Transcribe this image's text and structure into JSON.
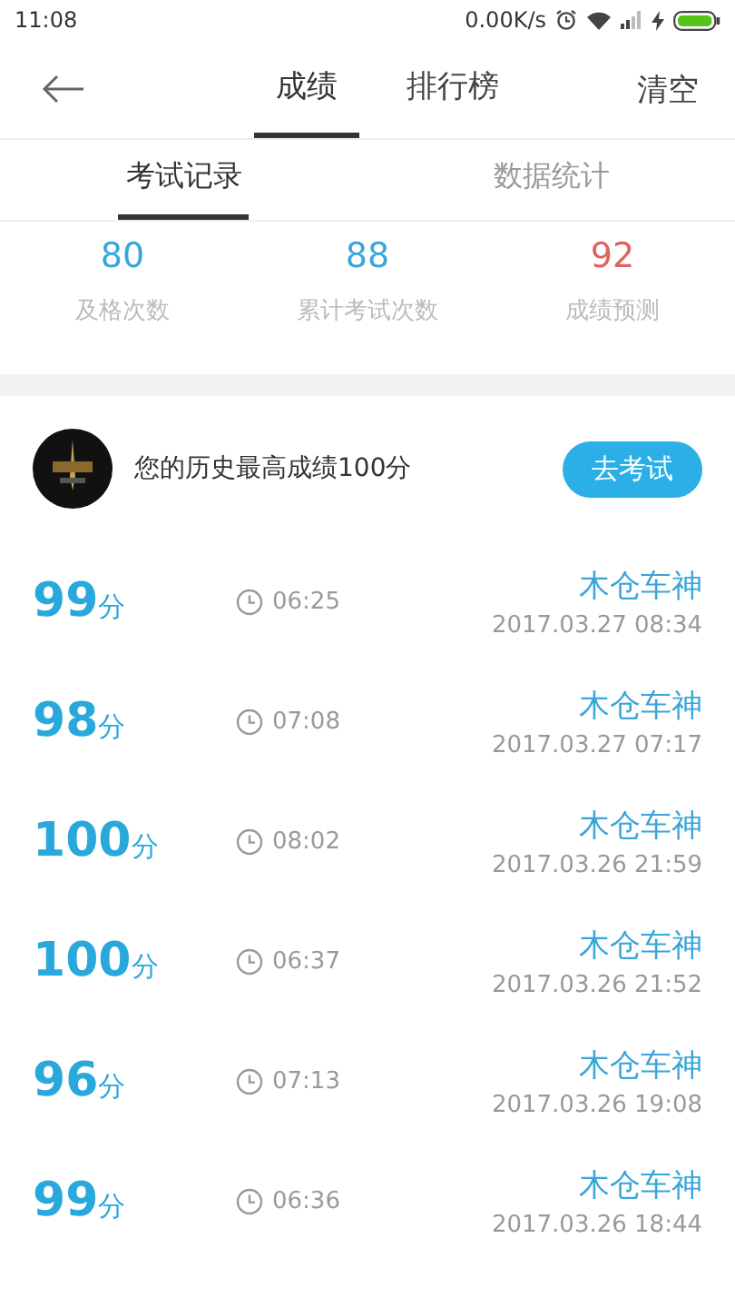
{
  "status_bar": {
    "time": "11:08",
    "speed": "0.00K/s"
  },
  "header": {
    "tabs": [
      {
        "label": "成绩",
        "selected": true
      },
      {
        "label": "排行榜",
        "selected": false
      }
    ],
    "action": "清空"
  },
  "sub_tabs": [
    {
      "label": "考试记录",
      "selected": true
    },
    {
      "label": "数据统计",
      "selected": false
    }
  ],
  "stats": [
    {
      "value": "80",
      "label": "及格次数",
      "color": "#3aa6d8"
    },
    {
      "value": "88",
      "label": "累计考试次数",
      "color": "#3aa6d8"
    },
    {
      "value": "92",
      "label": "成绩预测",
      "color": "#e0625c"
    }
  ],
  "best": {
    "text": "您的历史最高成绩100分",
    "button": "去考试"
  },
  "records": [
    {
      "score": "99",
      "unit": "分",
      "duration": "06:25",
      "name": "木仓车神",
      "date": "2017.03.27  08:34"
    },
    {
      "score": "98",
      "unit": "分",
      "duration": "07:08",
      "name": "木仓车神",
      "date": "2017.03.27  07:17"
    },
    {
      "score": "100",
      "unit": "分",
      "duration": "08:02",
      "name": "木仓车神",
      "date": "2017.03.26  21:59"
    },
    {
      "score": "100",
      "unit": "分",
      "duration": "06:37",
      "name": "木仓车神",
      "date": "2017.03.26  21:52"
    },
    {
      "score": "96",
      "unit": "分",
      "duration": "07:13",
      "name": "木仓车神",
      "date": "2017.03.26  19:08"
    },
    {
      "score": "99",
      "unit": "分",
      "duration": "06:36",
      "name": "木仓车神",
      "date": "2017.03.26  18:44"
    }
  ]
}
